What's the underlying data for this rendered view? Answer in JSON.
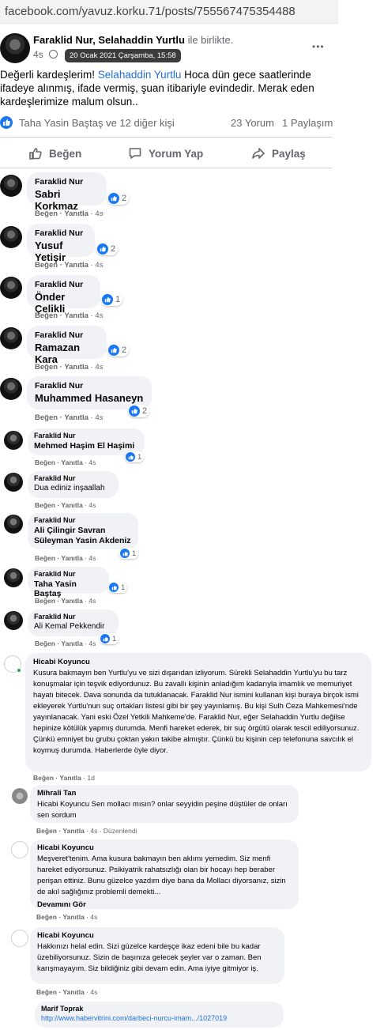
{
  "url": "facebook.com/yavuz.korku.71/posts/755567475354488",
  "post": {
    "author": "Faraklid Nur",
    "with_name": "Selahaddin Yurtlu",
    "with_suffix": "ile birlikte.",
    "time": "4s",
    "tooltip": "20 Ocak 2021 Çarşamba, 15:58",
    "more": "•••",
    "text_1": "Değerli kardeşlerim! ",
    "text_link": "Selahaddin Yurtlu",
    "text_2": " Hoca dün gece saatlerinde ifadeye alınmış, ifade vermiş, şuan itibariyle evindedir. Merak eden kardeşlerimize malum olsun..",
    "reactors": "Taha Yasin Baştaş ve 12 diğer kişi",
    "comments_count": "23 Yorum",
    "shares_count": "1 Paylaşım"
  },
  "actions": {
    "like": "Beğen",
    "comment": "Yorum Yap",
    "share": "Paylaş"
  },
  "footer": {
    "like": "Beğen",
    "sep": " · ",
    "reply": "Yanıtla"
  },
  "comments": [
    {
      "name": "Faraklid Nur",
      "text": "Sabri Korkmaz",
      "count": "2",
      "time": "4s"
    },
    {
      "name": "Faraklid Nur",
      "text": "Yusuf Yetişir",
      "count": "2",
      "time": "4s"
    },
    {
      "name": "Faraklid Nur",
      "text": "Önder Çelikli",
      "count": "1",
      "time": "4s"
    },
    {
      "name": "Faraklid Nur",
      "text": "Ramazan Kara",
      "count": "2",
      "time": "4s"
    },
    {
      "name": "Faraklid Nur",
      "text": "Muhammed Hasaneyn",
      "count": "2",
      "time": "4s"
    },
    {
      "name": "Faraklid Nur",
      "text": "Mehmed Haşim El Haşimi",
      "count": "1",
      "time": "4s"
    },
    {
      "name": "Faraklid Nur",
      "text": "Dua ediniz inşaallah",
      "count": "",
      "time": "4s"
    },
    {
      "name": "Faraklid Nur",
      "text": "Ali Çilingir Savran",
      "text2": "Süleyman Yasin Akdeniz",
      "count": "1",
      "time": "4s"
    },
    {
      "name": "Faraklid Nur",
      "text": "Taha Yasin Baştaş",
      "count": "1",
      "time": "4s"
    },
    {
      "name": "Faraklid Nur",
      "text": "Ali Kemal Pekkendir",
      "count": "1",
      "time": "4s"
    }
  ],
  "hicabi1": {
    "name": "Hicabi Koyuncu",
    "text": "Kusura bakmayın ben Yurtlu'yu ve sizi dışarıdan izliyorum. Sürekli Selahaddin Yurtlu'yu bu tarz konuşmalar için teşvik ediyordunuz. Bu zavallı kişinin anladığım kadarıyla imamlık ve memuriyet hayatı bitecek. Dava sonunda da tutuklanacak. Faraklid Nur ismini kullanan kişi buraya birçok ismi ekleyerek Yurtlu'nun suç ortakları listesi gibi bir şey yayınlamış. Bu kişi Sulh Ceza Mahkemesi'nde yayınlanacak. Yani eski Özel Yetkili Mahkeme'de. Faraklid Nur, eğer Selahaddin Yurtlu değilse hepinize kötülük yapmış durumda. Menfi hareket ederek, bir suç örgütü olarak tescil ediliyorsunuz. Çünkü emniyet bu grubu çoktan yakın takibe almıştır. Çünkü bu kişinin cep telefonuna savcılık el koymuş durumda. Haberlerde öyle diyor.",
    "time": "1d"
  },
  "mihrali": {
    "name": "Mihrali Tan",
    "text": "Hicabi Koyuncu Sen mollacı mısın? onlar seyyidin peşine düştüler de onları sen sordum",
    "time": "4s",
    "edited": "Düzenlendi"
  },
  "hicabi2": {
    "name": "Hicabi Koyuncu",
    "text": "Meşveret'tenim. Ama kusura bakmayın ben aklımı yemedim. Siz menfi hareket ediyorsunuz. Psikiyatrik rahatsızlığı olan bir hocayı hep beraber perişan ettiniz. Bunu güzelce yazdım diye bana da Mollacı diyorsanız, sizin de akıl sağlığınız problemli demekti...",
    "more": "Devamını Gör",
    "time": "4s"
  },
  "hicabi3": {
    "name": "Hicabi Koyuncu",
    "text": "Hakkınızı helal edin. Sizi güzelce kardeşçe ikaz edeni bile bu kadar üzebiliyorsunuz. Sizin de başınıza gelecek şeyler var o zaman. Ben karışmayayım. Siz bildiğiniz gibi devam edin. Ama iyiye gitmiyor iş.",
    "time": "4s"
  },
  "marif": {
    "name": "Marif Toprak",
    "link": "http://www.habervitrini.com/darbeci-nurcu-imam.../1027019"
  },
  "colors": {
    "accent": "#1877f2",
    "link": "#216fdb",
    "bubble": "#f0f2f5",
    "muted": "#65676b"
  }
}
